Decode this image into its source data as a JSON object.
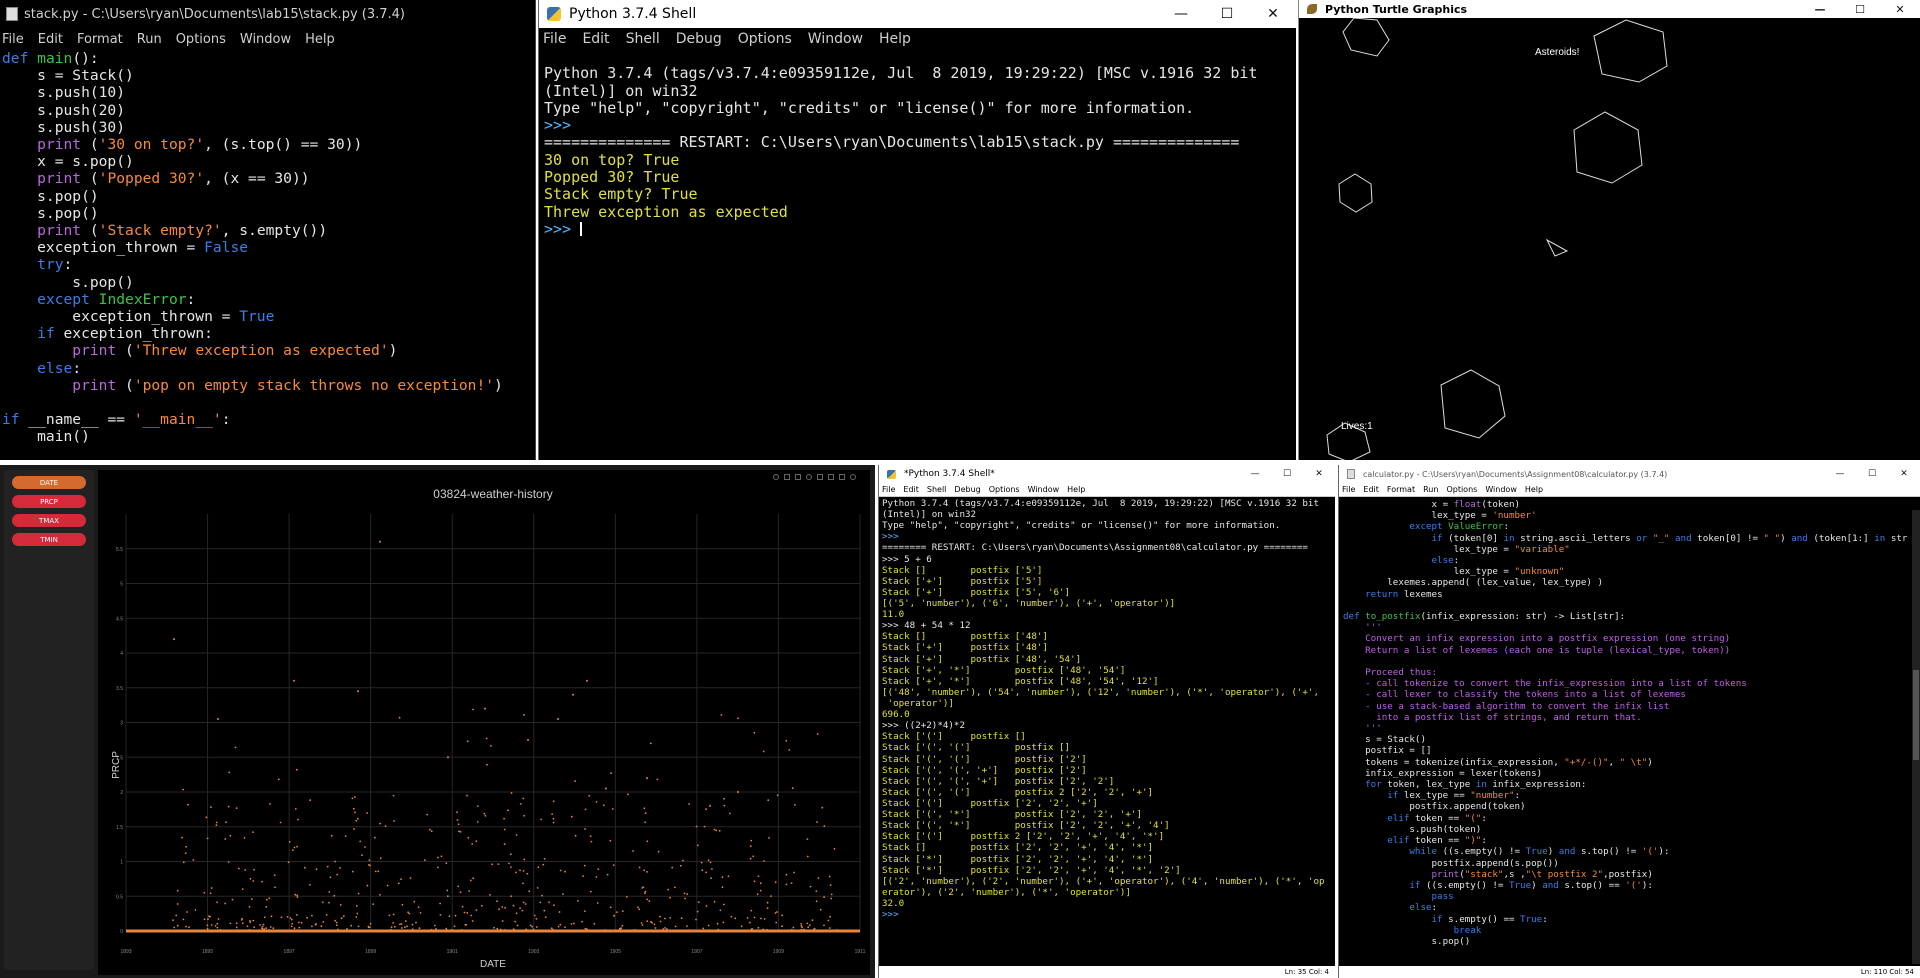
{
  "editor1": {
    "title": "stack.py - C:\\Users\\ryan\\Documents\\lab15\\stack.py (3.7.4)",
    "menu": [
      "File",
      "Edit",
      "Format",
      "Run",
      "Options",
      "Window",
      "Help"
    ]
  },
  "shell1": {
    "title": "Python 3.7.4 Shell",
    "menu": [
      "File",
      "Edit",
      "Shell",
      "Debug",
      "Options",
      "Window",
      "Help"
    ],
    "lines": [
      "Python 3.7.4 (tags/v3.7.4:e09359112e, Jul  8 2019, 19:29:22) [MSC v.1916 32 bit",
      "(Intel)] on win32",
      "Type \"help\", \"copyright\", \"credits\" or \"license()\" for more information.",
      ">>> ",
      "============== RESTART: C:\\Users\\ryan\\Documents\\lab15\\stack.py ==============",
      "30 on top? True",
      "Popped 30? True",
      "Stack empty? True",
      "Threw exception as expected",
      ">>> "
    ]
  },
  "turtle": {
    "title": "Python Turtle Graphics",
    "label_asteroids": "Asteroids!",
    "label_lives": "Lives:1"
  },
  "weather": {
    "buttons": [
      "DATE",
      "PRCP",
      "TMAX",
      "TMIN"
    ],
    "button_colors": [
      "#d46a2e",
      "#d42a3a",
      "#d42a3a",
      "#d42a3a"
    ],
    "chart_data": {
      "type": "scatter",
      "title": "03824-weather-history",
      "xlabel": "DATE",
      "ylabel": "PRCP",
      "xticks": [
        "1893",
        "1895",
        "1897",
        "1899",
        "1901",
        "1903",
        "1905",
        "1907",
        "1909",
        "1911"
      ],
      "yticks": [
        "0",
        "0.5",
        "1",
        "1.5",
        "2",
        "2.5",
        "3",
        "3.5",
        "4",
        "4.5",
        "5",
        "5.5"
      ],
      "ylim": [
        0,
        6
      ],
      "series_color": "#e8843a",
      "grid": true
    }
  },
  "shell2": {
    "title": "*Python 3.7.4 Shell*",
    "menu": [
      "File",
      "Edit",
      "Shell",
      "Debug",
      "Options",
      "Window",
      "Help"
    ],
    "lines": [
      "Python 3.7.4 (tags/v3.7.4:e09359112e, Jul  8 2019, 19:29:22) [MSC v.1916 32 bit",
      "(Intel)] on win32",
      "Type \"help\", \"copyright\", \"credits\" or \"license()\" for more information.",
      ">>> ",
      "======== RESTART: C:\\Users\\ryan\\Documents\\Assignment08\\calculator.py ========",
      ">>> 5 + 6",
      "Stack []        postfix ['5']",
      "Stack ['+']     postfix ['5']",
      "Stack ['+']     postfix ['5', '6']",
      "[('5', 'number'), ('6', 'number'), ('+', 'operator')]",
      "11.0",
      ">>> 48 + 54 * 12",
      "Stack []        postfix ['48']",
      "Stack ['+']     postfix ['48']",
      "Stack ['+']     postfix ['48', '54']",
      "Stack ['+', '*']        postfix ['48', '54']",
      "Stack ['+', '*']        postfix ['48', '54', '12']",
      "[('48', 'number'), ('54', 'number'), ('12', 'number'), ('*', 'operator'), ('+',",
      " 'operator')]",
      "696.0",
      ">>> ((2+2)*4)*2",
      "Stack ['(']     postfix []",
      "Stack ['(', '(']        postfix []",
      "Stack ['(', '(']        postfix ['2']",
      "Stack ['(', '(', '+']   postfix ['2']",
      "Stack ['(', '(', '+']   postfix ['2', '2']",
      "Stack ['(', '(']        postfix 2 ['2', '2', '+']",
      "Stack ['(']     postfix ['2', '2', '+']",
      "Stack ['(', '*']        postfix ['2', '2', '+']",
      "Stack ['(', '*']        postfix ['2', '2', '+', '4']",
      "Stack ['(']     postfix 2 ['2', '2', '+', '4', '*']",
      "Stack []        postfix ['2', '2', '+', '4', '*']",
      "Stack ['*']     postfix ['2', '2', '+', '4', '*']",
      "Stack ['*']     postfix ['2', '2', '+', '4', '*', '2']",
      "[('2', 'number'), ('2', 'number'), ('+', 'operator'), ('4', 'number'), ('*', 'op",
      "erator'), ('2', 'number'), ('*', 'operator')]",
      "32.0",
      ">>> "
    ],
    "status": "Ln: 35  Col: 4"
  },
  "editor2": {
    "title": "calculator.py - C:\\Users\\ryan\\Documents\\Assignment08\\calculator.py (3.7.4)",
    "menu": [
      "File",
      "Edit",
      "Format",
      "Run",
      "Options",
      "Window",
      "Help"
    ],
    "status": "Ln: 110  Col: 54"
  }
}
